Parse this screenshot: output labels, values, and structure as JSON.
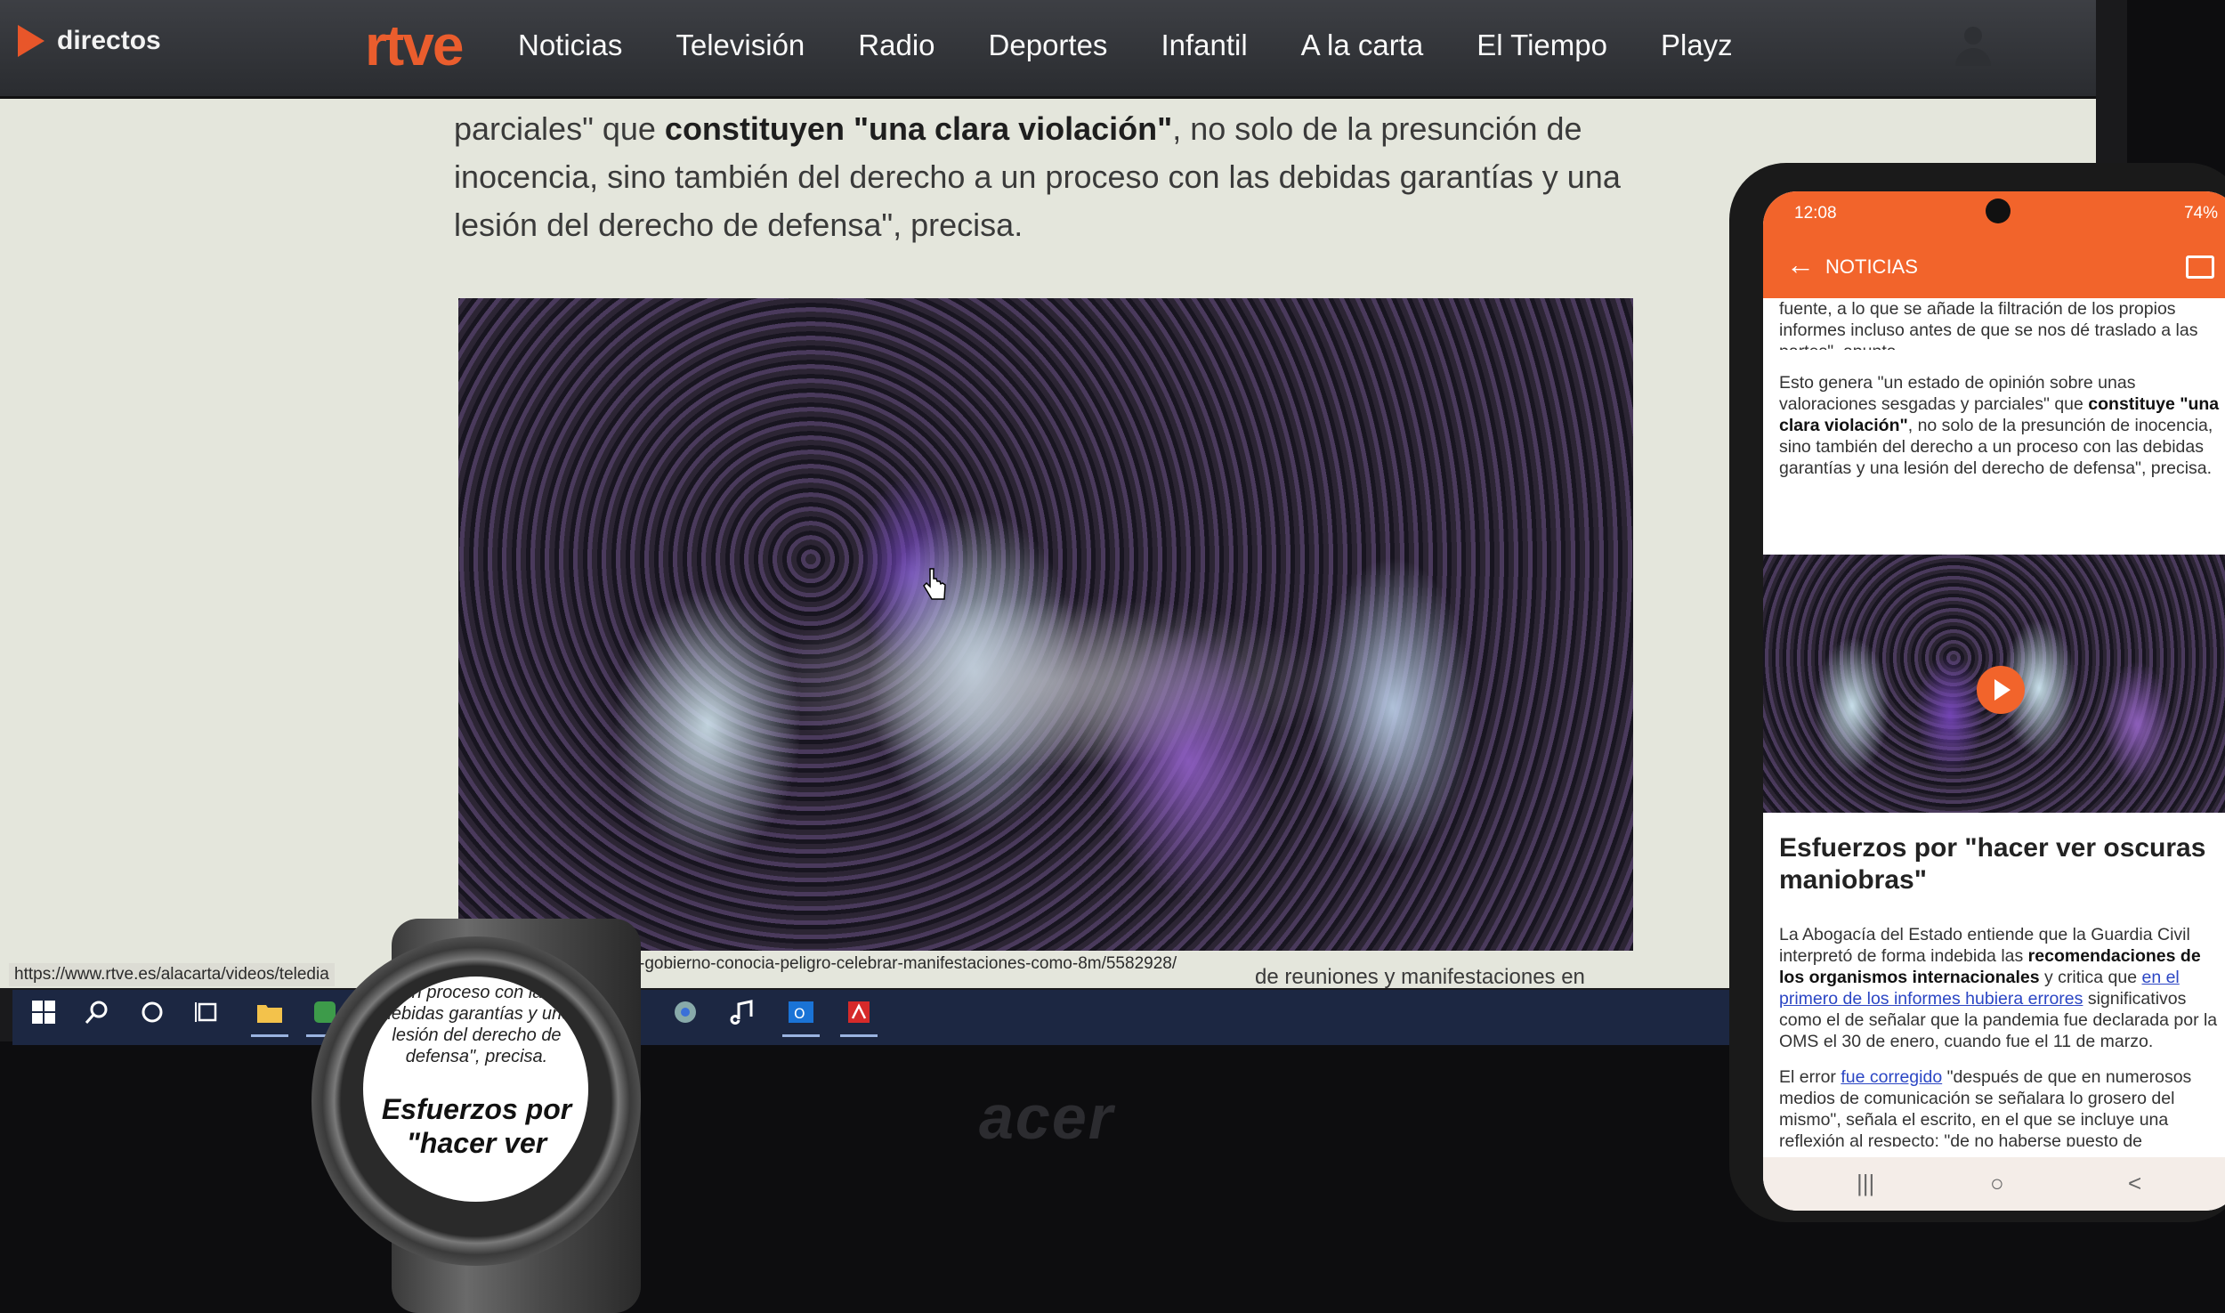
{
  "desktop": {
    "nav": {
      "live_label": "directos",
      "logo": "rtve",
      "items": [
        "Noticias",
        "Televisión",
        "Radio",
        "Deportes",
        "Infantil",
        "A la carta",
        "El Tiempo",
        "Playz"
      ]
    },
    "article": {
      "line1_pre": "parciales\" que ",
      "line1_bold": "constituyen \"una clara violación\"",
      "line1_post": ", no solo de la presunción de",
      "line2": "inocencia, sino también del derecho a un proceso con las debidas garantías y una",
      "line3": "lesión del derecho de defensa\", precisa."
    },
    "status_url_left": "https://www.rtve.es/alacarta/videos/teledia",
    "status_url_right": "gura-gobierno-conocia-peligro-celebrar-manifestaciones-como-8m/5582928/",
    "article_tail": "de reuniones y manifestaciones en",
    "taskbar_icons": [
      "windows-icon",
      "search-icon",
      "cortana-icon",
      "task-view-icon",
      "file-explorer-icon",
      "app-icon",
      "chrome-icon",
      "music-icon",
      "outlook-icon",
      "pdf-icon"
    ],
    "monitor_brand": "acer"
  },
  "phone": {
    "status_time": "12:08",
    "status_battery": "74%",
    "bar_title": "NOTICIAS",
    "p1": "fuente, a lo que se añade la filtración de los propios informes incluso antes de que se nos dé traslado a las partes\", apunta.",
    "p2_pre": "Esto genera \"un estado de opinión sobre unas valoraciones sesgadas y parciales\" que ",
    "p2_bold": "constituye \"una clara violación\"",
    "p2_post": ", no solo de la presunción de inocencia, sino también del derecho a un proceso con las debidas garantías y una lesión del derecho de defensa\", precisa.",
    "heading": "Esfuerzos por \"hacer ver oscuras maniobras\"",
    "p3_pre": "La Abogacía del Estado entiende que la Guardia Civil interpretó de forma indebida las ",
    "p3_bold": "recomendaciones de los organismos internacionales",
    "p3_mid": " y critica que ",
    "p3_link": "en el primero de los informes hubiera errores",
    "p3_post": " significativos como el de señalar que la pandemia fue declarada por la OMS el 30 de enero, cuando fue el 11 de marzo.",
    "p4_pre": "El error ",
    "p4_link": "fue corregido",
    "p4_post": " \"después de que en numerosos medios de comunicación se señalara lo grosero del mismo\", señala el escrito, en el que se incluye una reflexión al respecto: \"de no haberse puesto de",
    "nav": [
      "|||",
      "○",
      "<"
    ]
  },
  "watch": {
    "small_text": "un proceso con las debidas garantías y una lesión del derecho de defensa\", precisa.",
    "big_text": "Esfuerzos por \"hacer ver"
  }
}
